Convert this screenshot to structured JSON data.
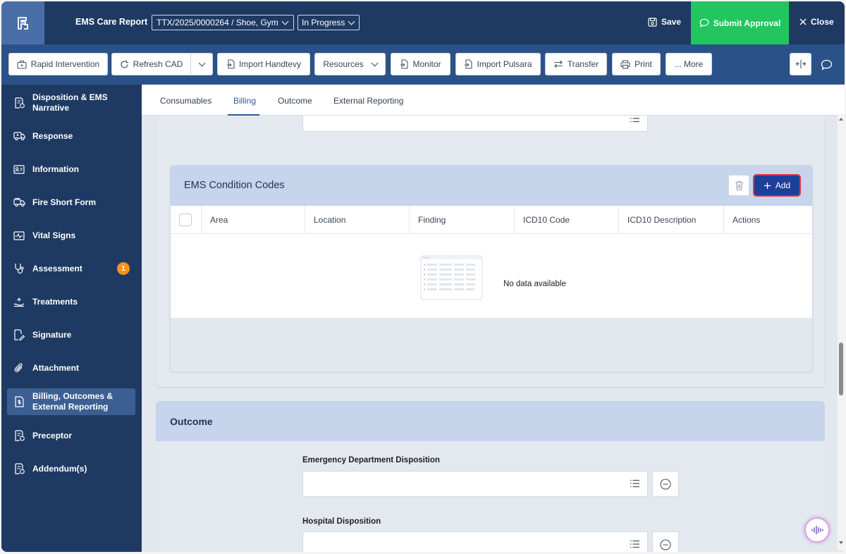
{
  "header": {
    "app_title": "EMS Care Report",
    "incident": "TTX/2025/0000264 / Shoe, Gym",
    "status": "In Progress",
    "save_label": "Save",
    "submit_label": "Submit Approval",
    "close_label": "Close"
  },
  "toolbar": {
    "rapid_intervention": "Rapid Intervention",
    "refresh_cad": "Refresh CAD",
    "import_handtevy": "Import Handtevy",
    "resources": "Resources",
    "monitor": "Monitor",
    "import_pulsara": "Import Pulsara",
    "transfer": "Transfer",
    "print": "Print",
    "more": "... More"
  },
  "sidebar": {
    "items": [
      {
        "label": "Disposition & EMS Narrative"
      },
      {
        "label": "Response"
      },
      {
        "label": "Information"
      },
      {
        "label": "Fire Short Form"
      },
      {
        "label": "Vital Signs"
      },
      {
        "label": "Assessment",
        "badge": "1"
      },
      {
        "label": "Treatments"
      },
      {
        "label": "Signature"
      },
      {
        "label": "Attachment"
      },
      {
        "label": "Billing, Outcomes & External Reporting"
      },
      {
        "label": "Preceptor"
      },
      {
        "label": "Addendum(s)"
      }
    ]
  },
  "tabs": [
    {
      "label": "Consumables"
    },
    {
      "label": "Billing"
    },
    {
      "label": "Outcome"
    },
    {
      "label": "External Reporting"
    }
  ],
  "condition_codes": {
    "title": "EMS Condition Codes",
    "add_label": "Add",
    "columns": [
      "Area",
      "Location",
      "Finding",
      "ICD10 Code",
      "ICD10 Description",
      "Actions"
    ],
    "empty_text": "No data available"
  },
  "outcome": {
    "title": "Outcome",
    "fields": [
      {
        "label": "Emergency Department Disposition",
        "value": ""
      },
      {
        "label": "Hospital Disposition",
        "value": ""
      }
    ]
  },
  "colors": {
    "nav_bg": "#1e3a63",
    "toolbar_bg": "#2a5288",
    "submit_green": "#22c55e",
    "add_button": "#1d3f9a",
    "highlight_border": "#e0364c",
    "badge_orange": "#f7931e"
  }
}
